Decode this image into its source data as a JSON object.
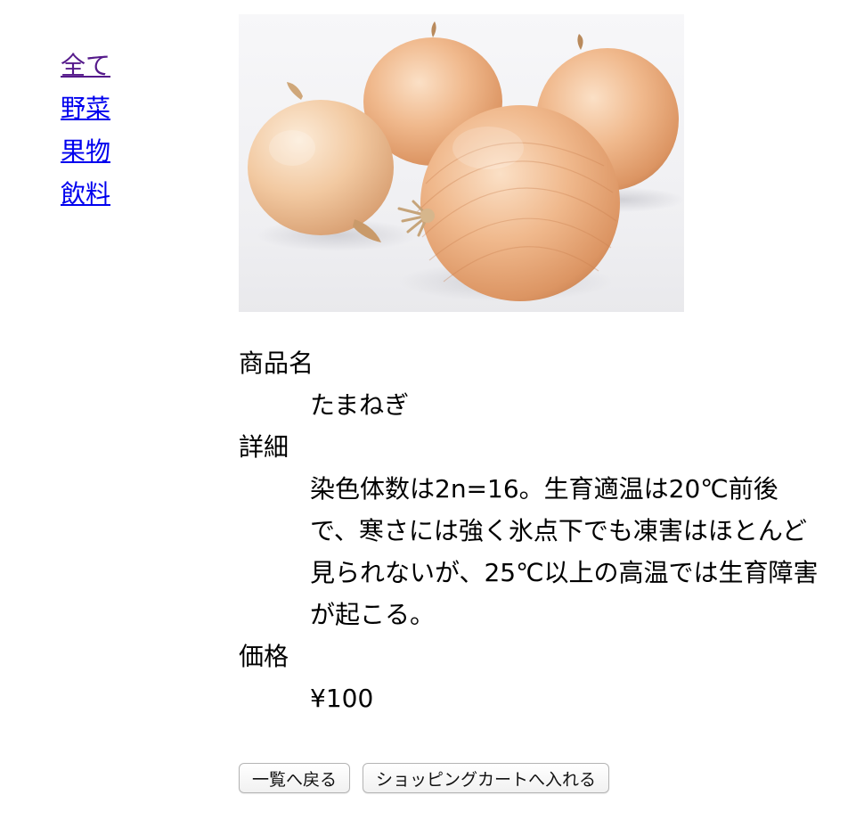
{
  "categories": [
    {
      "label": "全て",
      "visited": true
    },
    {
      "label": "野菜",
      "visited": false
    },
    {
      "label": "果物",
      "visited": false
    },
    {
      "label": "飲料",
      "visited": false
    }
  ],
  "product": {
    "name_label": "商品名",
    "name": "たまねぎ",
    "detail_label": "詳細",
    "detail": "染色体数は2n=16。生育適温は20℃前後で、寒さには強く氷点下でも凍害はほとんど見られないが、25℃以上の高温では生育障害が起こる。",
    "price_label": "価格",
    "price": "¥100",
    "image_icon": "onions-photo"
  },
  "buttons": {
    "back_label": "一覧へ戻る",
    "cart_label": "ショッピングカートへ入れる"
  },
  "colors": {
    "link": "#0000ee",
    "link_visited": "#551a8b",
    "onion": "#e8a277"
  }
}
